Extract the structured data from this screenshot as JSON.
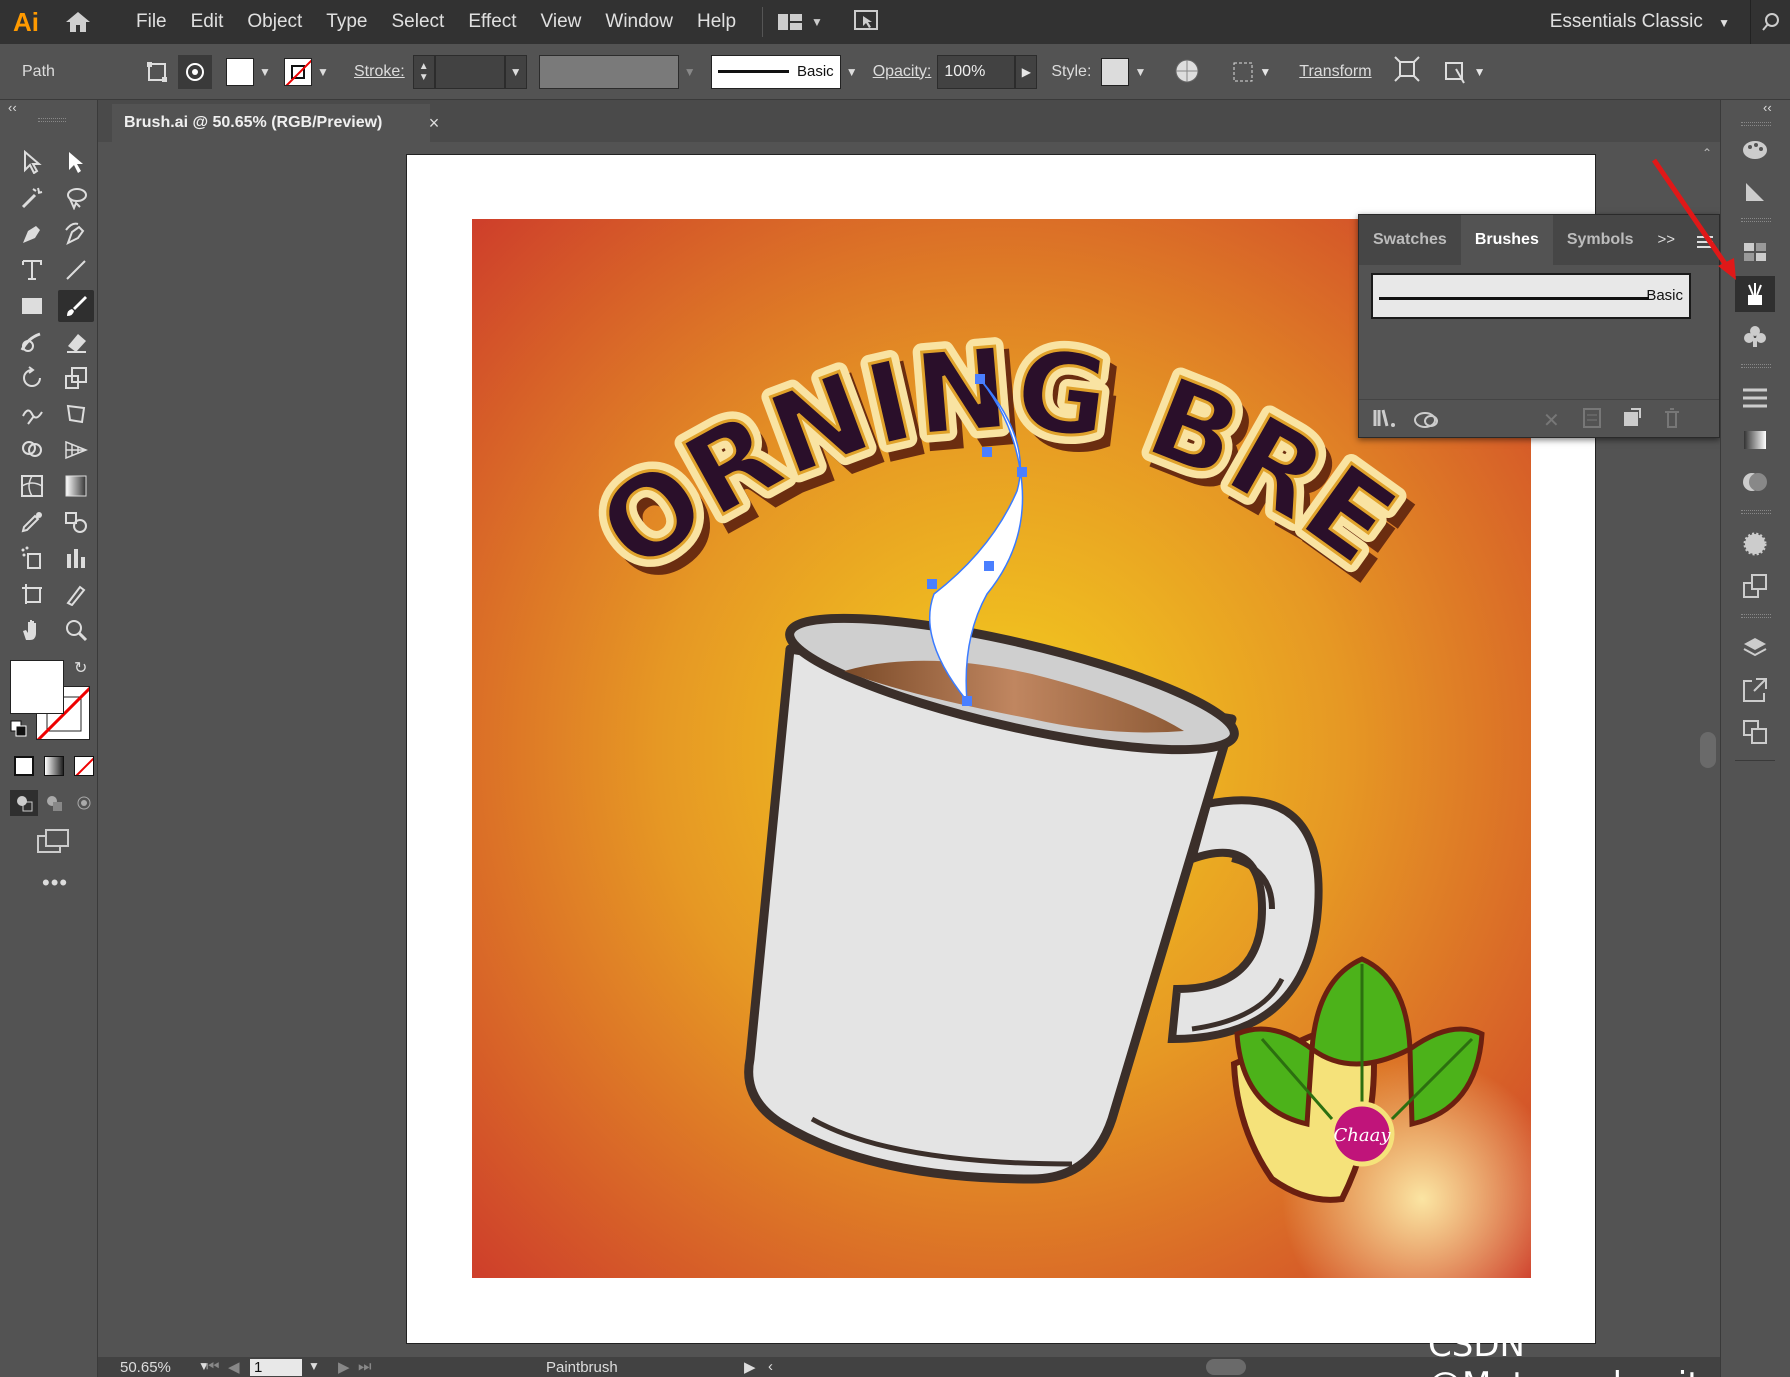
{
  "app": {
    "logo": "Ai",
    "home_icon": "home-icon"
  },
  "menu": [
    "File",
    "Edit",
    "Object",
    "Type",
    "Select",
    "Effect",
    "View",
    "Window",
    "Help"
  ],
  "workspace": "Essentials Classic",
  "control": {
    "selection_type": "Path",
    "stroke_label": "Stroke:",
    "brush_name": "Basic",
    "opacity_label": "Opacity:",
    "opacity_value": "100%",
    "style_label": "Style:",
    "transform_label": "Transform"
  },
  "document": {
    "tab_title": "Brush.ai @ 50.65% (RGB/Preview)",
    "close": "×"
  },
  "artwork": {
    "headline": "MORNING BREW",
    "logo_text": "Chaay",
    "colors": {
      "bg_inner": "#f2c81c",
      "bg_outer": "#cf3a2c",
      "text_fill": "#2a0f2a",
      "text_outline": "#f9e3a2",
      "mug": "#e4e4e4",
      "outline": "#3b2f2a",
      "leaf": "#4cb21a",
      "badge": "#c0147a"
    }
  },
  "brushes_panel": {
    "tabs": [
      "Swatches",
      "Brushes",
      "Symbols"
    ],
    "active_tab": "Brushes",
    "overflow": ">>",
    "brush_item": "Basic"
  },
  "status": {
    "zoom": "50.65%",
    "page": "1",
    "tool": "Paintbrush"
  },
  "watermark": "CSDN @Metamodernity"
}
